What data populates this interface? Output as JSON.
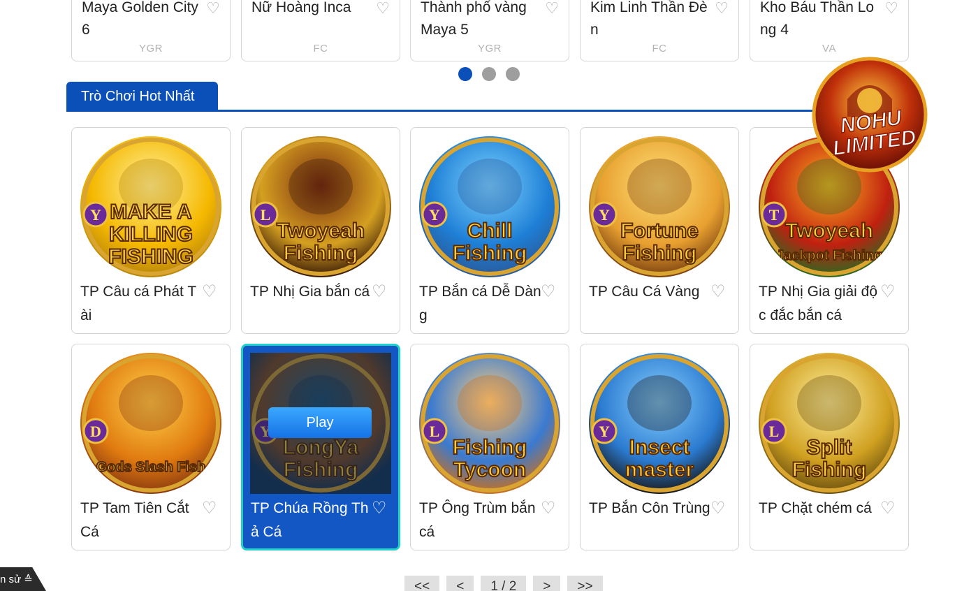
{
  "top_row": [
    {
      "name": "Maya Golden City6",
      "provider": "YGR"
    },
    {
      "name": "Nữ Hoàng Inca",
      "provider": "FC"
    },
    {
      "name": "Thành phố vàng Maya 5",
      "provider": "YGR"
    },
    {
      "name": "Kim Linh Thần Đèn",
      "provider": "FC"
    },
    {
      "name": "Kho Báu Thần Long 4",
      "provider": "VA"
    }
  ],
  "carousel": {
    "dots": 3,
    "active": 0
  },
  "section": {
    "title": "Trò Chơi Hot Nhất"
  },
  "badge": {
    "line1": "NOHU",
    "line2": "LIMITED"
  },
  "games": [
    {
      "title": "TP Câu cá Phát Tài",
      "art_line1": "MAKE A",
      "art_line2": "KILLING",
      "art_line3": "FISHING",
      "letter": "Y",
      "colors": [
        "#fff2a0",
        "#f5b800",
        "#b8860b"
      ]
    },
    {
      "title": "TP Nhị Gia bắn cá",
      "art_line1": "Twoyeah",
      "art_line2": "Fishing",
      "art_line3": "",
      "letter": "L",
      "colors": [
        "#7a2a10",
        "#d4a020",
        "#3a1a08"
      ]
    },
    {
      "title": "TP Bắn cá Dễ Dàng",
      "art_line1": "Chill",
      "art_line2": "Fishing",
      "art_line3": "",
      "letter": "Y",
      "colors": [
        "#7fd4ff",
        "#1e7fd6",
        "#2a5a9a"
      ]
    },
    {
      "title": "TP Câu Cá Vàng",
      "art_line1": "Fortune",
      "art_line2": "Fishing",
      "art_line3": "",
      "letter": "Y",
      "colors": [
        "#ffe27a",
        "#e8a030",
        "#7a4010"
      ]
    },
    {
      "title": "TP Nhị Gia giải độc đắc bắn cá",
      "art_line1": "Twoyeah",
      "art_line2": "Jackpot Fishing",
      "art_line3": "",
      "letter": "T",
      "colors": [
        "#ffb020",
        "#c02010",
        "#2a6a20"
      ]
    },
    {
      "title": "TP Tam Tiên Cắt Cá",
      "art_line1": "Gods Slash Fish",
      "art_line2": "",
      "art_line3": "",
      "letter": "D",
      "colors": [
        "#ffd24a",
        "#e07a10",
        "#8a3a10"
      ]
    },
    {
      "title": "TP Chúa Rồng Thả Cá",
      "art_line1": "LongYa",
      "art_line2": "Fishing",
      "art_line3": "",
      "letter": "Y",
      "colors": [
        "#2a6a8a",
        "#8a5020",
        "#1a3a5a"
      ],
      "hover": true,
      "play_label": "Play"
    },
    {
      "title": "TP Ông Trùm bắn cá",
      "art_line1": "Fishing",
      "art_line2": "Tycoon",
      "art_line3": "",
      "letter": "L",
      "colors": [
        "#ffd080",
        "#3a7ad0",
        "#c87020"
      ]
    },
    {
      "title": "TP Bắn Côn Trùng",
      "art_line1": "Insect",
      "art_line2": "master",
      "art_line3": "",
      "letter": "Y",
      "colors": [
        "#8ad0ff",
        "#2a7ad0",
        "#1a1a1a"
      ]
    },
    {
      "title": "TP Chặt chém cá",
      "art_line1": "Split",
      "art_line2": "Fishing",
      "art_line3": "",
      "letter": "L",
      "colors": [
        "#fff0a0",
        "#d0a020",
        "#6a5010"
      ]
    }
  ],
  "side_tab": {
    "label": "n sử ≙"
  },
  "pagination": {
    "first": "<<",
    "prev": "<",
    "page": "1 / 2",
    "next": ">",
    "last": ">>"
  }
}
